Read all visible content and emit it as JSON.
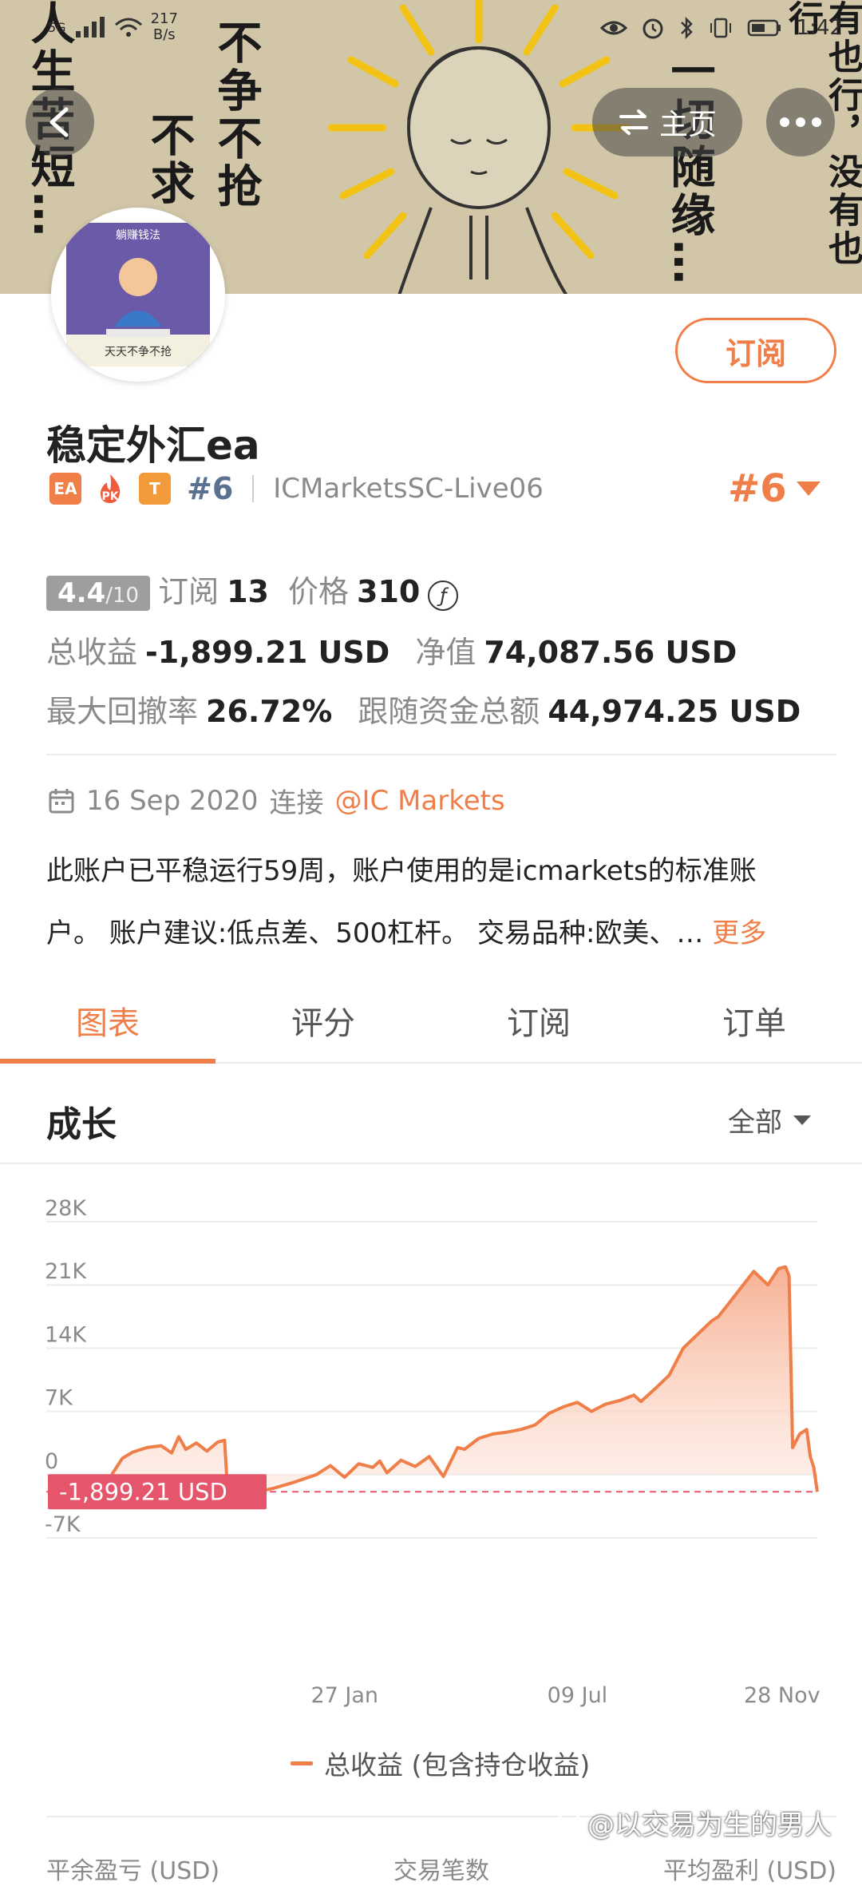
{
  "statusbar": {
    "network": "5G",
    "speed_value": "217",
    "speed_unit": "B/s",
    "time": "1:42"
  },
  "banner": {
    "text_left_1": "人生苦短…",
    "text_left_2": "不求",
    "text_left_3": "不争不抢",
    "text_right_1": "一切随缘…",
    "text_right_2": "有也行，没有也行"
  },
  "header": {
    "back_icon": "back-arrow-icon",
    "home_label": "主页",
    "more_icon": "more-dots-icon"
  },
  "avatar": {
    "caption_top": "躺赚钱法",
    "caption_bottom": "天天不争不抢"
  },
  "subscribe_label": "订阅",
  "profile": {
    "name": "稳定外汇ea",
    "tag_ea": "EA",
    "tag_pk": "PK",
    "tag_t": "T",
    "rank_small": "#6",
    "server": "ICMarketsSC-Live06",
    "rank_big": "#6"
  },
  "stats": {
    "rating": "4.4",
    "rating_max": "/10",
    "subs_label": "订阅",
    "subs_value": "13",
    "price_label": "价格",
    "price_value": "310",
    "price_currency_icon": "ƒ",
    "total_profit_label": "总收益",
    "total_profit_value": "-1,899.21 USD",
    "equity_label": "净值",
    "equity_value": "74,087.56 USD",
    "drawdown_label": "最大回撤率",
    "drawdown_value": "26.72%",
    "follow_label": "跟随资金总额",
    "follow_value": "44,974.25 USD"
  },
  "connection": {
    "date": "16 Sep 2020",
    "connect_label": "连接",
    "broker": "@IC Markets"
  },
  "description": {
    "line1": "此账户已平稳运行59周，账户使用的是icmarkets的标准账",
    "line2": "户。 账户建议:低点差、500杠杆。 交易品种:欧美、…",
    "more_label": "更多"
  },
  "tabs": [
    {
      "label": "图表",
      "active": true
    },
    {
      "label": "评分",
      "active": false
    },
    {
      "label": "订阅",
      "active": false
    },
    {
      "label": "订单",
      "active": false
    }
  ],
  "section": {
    "title": "成长",
    "filter_label": "全部"
  },
  "colors": {
    "accent": "#ef7e49",
    "badge_red": "#e5556b"
  },
  "chart_data": {
    "type": "area",
    "title": "",
    "xlabel": "",
    "ylabel": "",
    "ylim": [
      -7000,
      28000
    ],
    "y_ticks": [
      "28K",
      "21K",
      "14K",
      "7K",
      "0",
      "-7K"
    ],
    "y_tick_values": [
      28000,
      21000,
      14000,
      7000,
      0,
      -7000
    ],
    "x_ticks": [
      "27 Jan",
      "09 Jul",
      "28 Nov"
    ],
    "x_tick_positions": [
      0.33,
      0.66,
      0.95
    ],
    "current_value_label": "-1,899.21 USD",
    "current_value": -1899.21,
    "legend": "总收益 (包含持仓收益)",
    "series": [
      {
        "name": "总收益 (包含持仓收益)",
        "x": [
          0.0,
          0.015,
          0.03,
          0.05,
          0.07,
          0.085,
          0.095,
          0.105,
          0.12,
          0.135,
          0.15,
          0.16,
          0.165,
          0.18,
          0.2,
          0.23,
          0.26,
          0.29,
          0.31,
          0.33,
          0.35,
          0.37,
          0.38,
          0.39,
          0.41,
          0.43,
          0.45,
          0.47,
          0.49,
          0.5,
          0.52,
          0.54,
          0.56,
          0.58,
          0.6,
          0.62,
          0.64,
          0.66,
          0.68,
          0.7,
          0.72,
          0.74,
          0.75,
          0.77,
          0.79,
          0.81,
          0.83,
          0.85,
          0.86,
          0.875,
          0.885,
          0.9,
          0.91,
          0.93,
          0.945,
          0.955,
          0.96,
          0.965,
          0.975,
          0.985,
          0.99,
          0.995,
          1.0
        ],
        "values": [
          0,
          1800,
          2500,
          3000,
          3200,
          2400,
          4200,
          2800,
          3500,
          2600,
          3600,
          3800,
          -3000,
          -2800,
          -2000,
          -1500,
          -800,
          0,
          1000,
          -300,
          1200,
          800,
          1500,
          200,
          1600,
          900,
          2000,
          -200,
          3000,
          2800,
          4000,
          4500,
          4700,
          5000,
          5500,
          6800,
          7500,
          8000,
          7000,
          7800,
          8200,
          8800,
          8100,
          9500,
          11000,
          14000,
          15500,
          17000,
          17500,
          19000,
          20000,
          21500,
          22500,
          21000,
          22800,
          23000,
          22000,
          3000,
          4500,
          5000,
          2000,
          800,
          -1899.21
        ]
      }
    ]
  },
  "bottom": {
    "label_1": "平余盈亏 (USD)",
    "label_2": "交易笔数",
    "label_3": "平均盈利 (USD)"
  },
  "watermark": {
    "text": "@以交易为生的男人"
  }
}
